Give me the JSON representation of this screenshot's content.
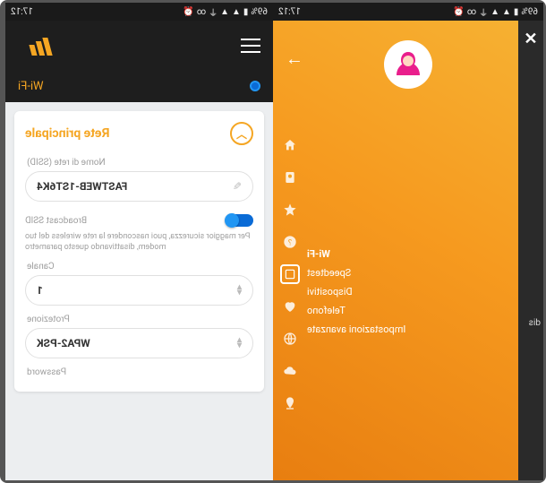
{
  "status": {
    "time": "17:12",
    "battery": "69%",
    "icons": [
      "alarm",
      "link",
      "wifi",
      "signal",
      "signal",
      "battery"
    ]
  },
  "left": {
    "tab": "Wi-Fi",
    "card_title": "Rete principale",
    "ssid_label": "Nome di rete (SSID)",
    "ssid_value": "FASTWEB-1ST6K4",
    "broadcast_label": "Broadcast SSID",
    "broadcast_hint": "Per maggior sicurezza, puoi nascondere la rete wireless del tuo modem, disattivando questo parametro",
    "channel_label": "Canale",
    "channel_value": "1",
    "protection_label": "Protezione",
    "protection_value": "WPA2-PSK",
    "password_label": "Password"
  },
  "right": {
    "sliver_text": "dis",
    "menu": {
      "wifi": "Wi-Fi",
      "speedtest": "Speedtest",
      "devices": "Dispositivi",
      "phone": "Telefono",
      "advanced": "Impostazioni avanzate"
    },
    "icons": [
      "home",
      "user",
      "star",
      "help",
      "wifi-selected",
      "heart",
      "globe",
      "cloud",
      "location"
    ]
  }
}
